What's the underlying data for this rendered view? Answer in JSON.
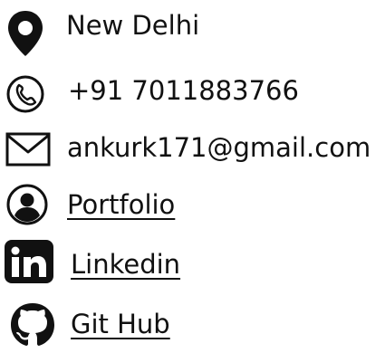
{
  "contact": {
    "location": {
      "icon": "location-pin-icon",
      "text": "New Delhi"
    },
    "phone": {
      "icon": "phone-icon",
      "text": "+91 7011883766"
    },
    "email": {
      "icon": "mail-icon",
      "text": "ankurk171@gmail.com"
    },
    "portfolio": {
      "icon": "user-icon",
      "text": "Portfolio"
    },
    "linkedin": {
      "icon": "linkedin-icon",
      "text": "Linkedin"
    },
    "github": {
      "icon": "github-icon",
      "text": "Git Hub"
    }
  },
  "colors": {
    "text": "#111111",
    "background": "#ffffff"
  }
}
